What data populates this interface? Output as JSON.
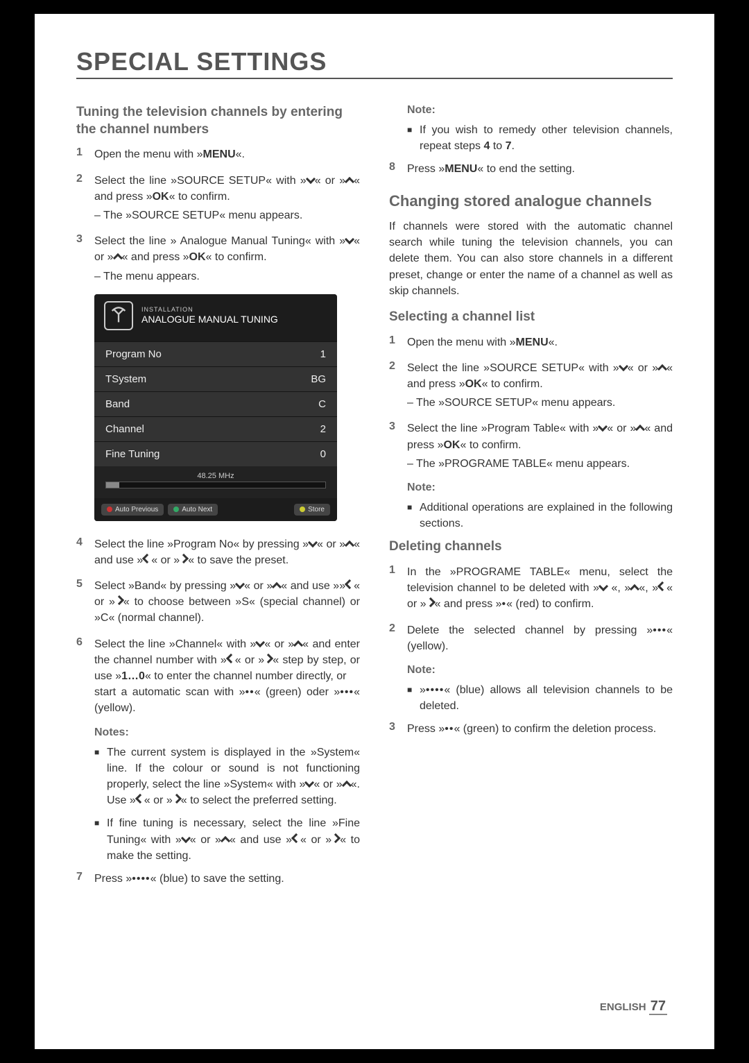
{
  "page_title": "SPECIAL SETTINGS",
  "left": {
    "h3": "Tuning the television channels by entering the channel numbers",
    "s1_a": "Open the menu with »",
    "s1_b": "MENU",
    "s1_c": "«.",
    "s2_a": "Select the line »SOURCE SETUP« with »",
    "s2_b": "« or »",
    "s2_c": "« and press »",
    "s2_d": "OK",
    "s2_e": "« to confirm.",
    "s2_sub": "– The »SOURCE SETUP« menu appears.",
    "s3_a": "Select the line » Analogue Manual Tuning« with »",
    "s3_b": "« or »",
    "s3_c": "« and press »",
    "s3_d": "OK",
    "s3_e": "« to confirm.",
    "s3_sub": "– The menu appears.",
    "s4_a": "Select the line »Program No« by pressing »",
    "s4_b": "« or »",
    "s4_c": "« and use »",
    "s4_d": "« or »",
    "s4_e": "« to save the preset.",
    "s5_a": "Select »Band« by pressing »",
    "s5_b": "« or »",
    "s5_c": "« and use »»",
    "s5_d": "« or »",
    "s5_e": "«  to choose between »S« (special channel) or »C« (normal channel).",
    "s6_a": "Select the line »Channel« with »",
    "s6_b": "« or »",
    "s6_c": "« and enter the channel number with »",
    "s6_d": "« or »",
    "s6_e": "« step by step, or use »",
    "s6_f": "1…0",
    "s6_g": "« to enter the channel number directly, or",
    "s6_h": "start a automatic scan with »",
    "s6_i": "« (green) oder »",
    "s6_j": "« (yellow).",
    "notes_label": "Notes:",
    "n1_a": "The current system is displayed in the »System« line. If the colour or sound is not functioning properly, select the line »System« with »",
    "n1_b": "« or »",
    "n1_c": "«. Use »",
    "n1_d": "« or »",
    "n1_e": "« to select the preferred setting.",
    "n2_a": "If fine tuning is necessary, select the line »Fine Tuning« with »",
    "n2_b": "« or »",
    "n2_c": "« and use »",
    "n2_d": "« or »",
    "n2_e": "« to make the setting.",
    "s7_a": "Press »",
    "s7_b": "« (blue) to save the setting."
  },
  "osd": {
    "t1": "INSTALLATION",
    "t2": "ANALOGUE MANUAL TUNING",
    "r1k": "Program No",
    "r1v": "1",
    "r2k": "TSystem",
    "r2v": "BG",
    "r3k": "Band",
    "r3v": "C",
    "r4k": "Channel",
    "r4v": "2",
    "r5k": "Fine Tuning",
    "r5v": "0",
    "freq": "48.25 MHz",
    "b_prev": "Auto Previous",
    "b_next": "Auto Next",
    "b_store": "Store"
  },
  "right": {
    "note_label": "Note:",
    "rn1_a": "If you wish to remedy other television channels, repeat steps ",
    "rn1_b": "4",
    "rn1_c": " to ",
    "rn1_d": "7",
    "rn1_e": ".",
    "s8_a": "Press »",
    "s8_b": "MENU",
    "s8_c": "« to end the setting.",
    "h2": "Changing stored analogue channels",
    "intro": "If channels were stored with the automatic channel search while tuning the television channels, you can delete them. You can also store channels in a different preset, change or enter the name of a channel as well as skip channels.",
    "h3a": "Selecting a channel list",
    "a1_a": "Open the menu with »",
    "a1_b": "MENU",
    "a1_c": "«.",
    "a2_a": "Select the line »SOURCE SETUP« with »",
    "a2_b": "« or »",
    "a2_c": "« and press »",
    "a2_d": "OK",
    "a2_e": "« to confirm.",
    "a2_sub": "– The »SOURCE SETUP« menu appears.",
    "a3_a": "Select the line »Program Table« with »",
    "a3_b": "« or »",
    "a3_c": "« and press »",
    "a3_d": "OK",
    "a3_e": "« to confirm.",
    "a3_sub": "– The »PROGRAME TABLE« menu appears.",
    "note2_label": "Note:",
    "note2": "Additional operations are explained in the following sections.",
    "h3b": "Deleting channels",
    "d1_a": "In the »PROGRAME TABLE« menu, select the television channel to be deleted with »",
    "d1_b": " «, »",
    "d1_c": "«, »",
    "d1_d": "« or »",
    "d1_e": "« and press »",
    "d1_f": "« (red) to confirm.",
    "d2_a": "Delete the selected channel by pressing »",
    "d2_b": "« (yellow).",
    "note3_label": "Note:",
    "d_n1_a": "»",
    "d_n1_b": "« (blue) allows all television channels to be deleted.",
    "d3_a": "Press »",
    "d3_b": "« (green) to confirm the deletion process."
  },
  "footer_lang": "ENGLISH",
  "footer_page": "77"
}
